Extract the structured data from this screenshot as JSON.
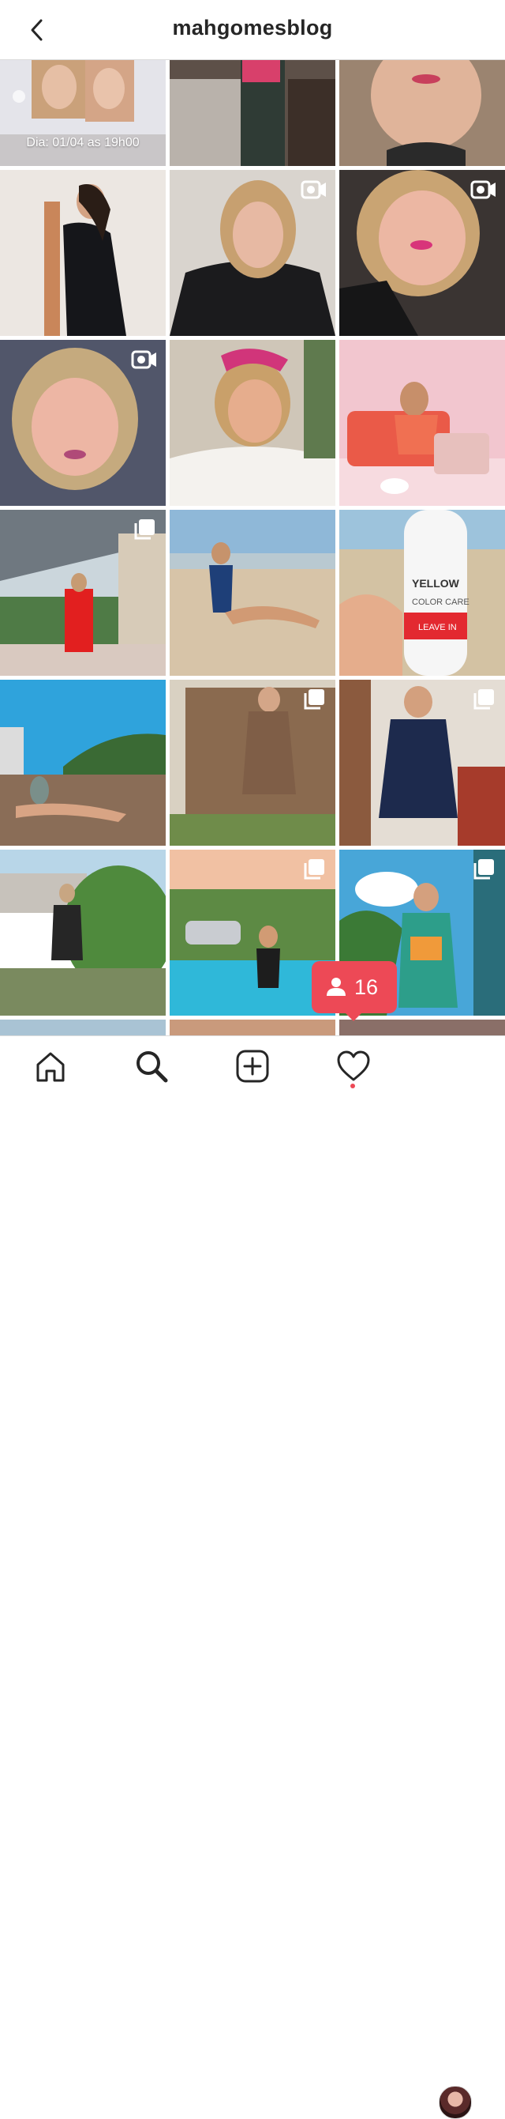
{
  "header": {
    "title": "mahgomesblog"
  },
  "post_caption": {
    "date_text": "Dia: 01/04 as 19h00"
  },
  "product": {
    "brand": "YELLOW",
    "line": "COLOR CARE",
    "variant": "LEAVE IN"
  },
  "activity_bubble": {
    "count": "16"
  },
  "colors": {
    "accent": "#ed4956",
    "header_text": "#262626",
    "divider": "#dbdbdb"
  },
  "grid": {
    "rows": [
      [
        "image",
        "image",
        "image"
      ],
      [
        "image",
        "video",
        "video"
      ],
      [
        "video",
        "image",
        "image"
      ],
      [
        "carousel",
        "image",
        "image"
      ],
      [
        "image",
        "carousel",
        "carousel"
      ],
      [
        "image",
        "carousel",
        "carousel"
      ],
      [
        "image",
        "image",
        "image"
      ]
    ]
  },
  "tabbar": {
    "items": [
      "home-icon",
      "search-icon",
      "new-post-icon",
      "activity-heart-icon",
      "profile-avatar"
    ]
  }
}
